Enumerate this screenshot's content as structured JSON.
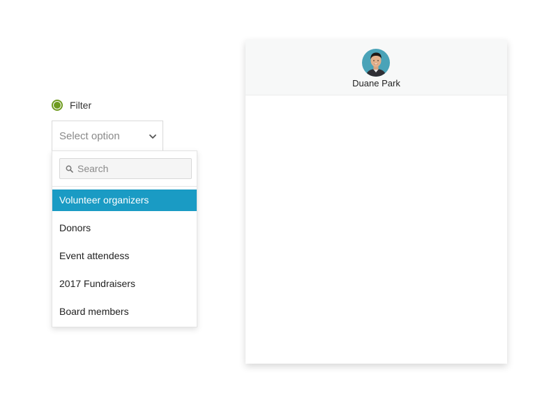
{
  "filter": {
    "label": "Filter",
    "radio_color": "#6f9b1f"
  },
  "select": {
    "placeholder": "Select option",
    "icon": "chevron-down-icon"
  },
  "dropdown": {
    "search_placeholder": "Search",
    "search_value": "",
    "selected_color": "#1a9bc4",
    "options": [
      {
        "label": "Volunteer organizers",
        "selected": true
      },
      {
        "label": "Donors",
        "selected": false
      },
      {
        "label": "Event attendess",
        "selected": false
      },
      {
        "label": "2017 Fundraisers",
        "selected": false
      },
      {
        "label": "Board members",
        "selected": false
      }
    ]
  },
  "profile": {
    "name": "Duane Park",
    "avatar_bg": "#4aa3b8"
  }
}
